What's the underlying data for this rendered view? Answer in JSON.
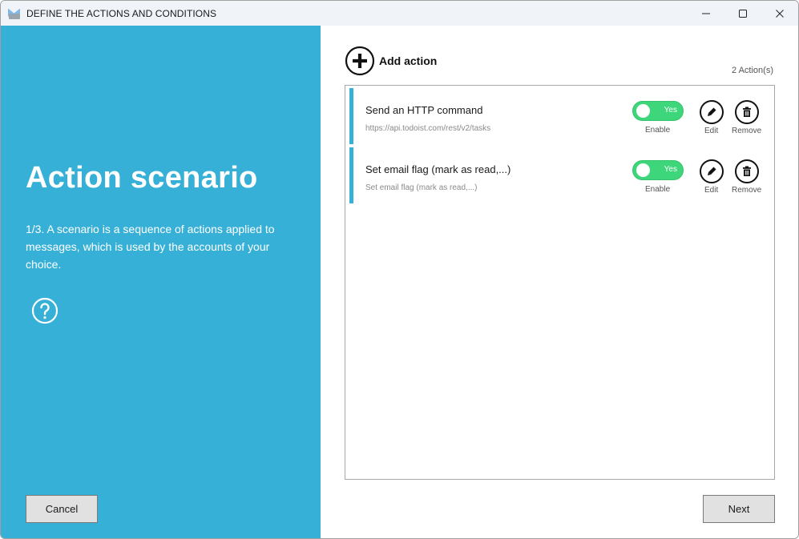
{
  "window": {
    "title": "DEFINE THE ACTIONS AND CONDITIONS",
    "icon": "mail-tray-icon",
    "controls": [
      "minimize-icon",
      "maximize-icon",
      "close-icon"
    ]
  },
  "left_panel": {
    "title": "Action scenario",
    "description": "1/3. A scenario is a sequence of actions applied to messages, which is used by the accounts of your choice.",
    "help_icon": "question-circle-icon",
    "cancel_label": "Cancel",
    "background_color": "#36b0d6"
  },
  "main": {
    "add_action_label": "Add action",
    "action_count": "2  Action(s)",
    "actions": [
      {
        "title": "Send an HTTP command",
        "subtitle": "https://api.todoist.com/rest/v2/tasks",
        "enabled": true,
        "toggle_label": "Yes",
        "enable_label": "Enable",
        "edit_label": "Edit",
        "remove_label": "Remove"
      },
      {
        "title": "Set email flag (mark as read,...)",
        "subtitle": "Set email flag (mark as read,...)",
        "enabled": true,
        "toggle_label": "Yes",
        "enable_label": "Enable",
        "edit_label": "Edit",
        "remove_label": "Remove"
      }
    ],
    "next_label": "Next",
    "toggle_color": "#3ed67a",
    "accent_color": "#36b0d6"
  }
}
